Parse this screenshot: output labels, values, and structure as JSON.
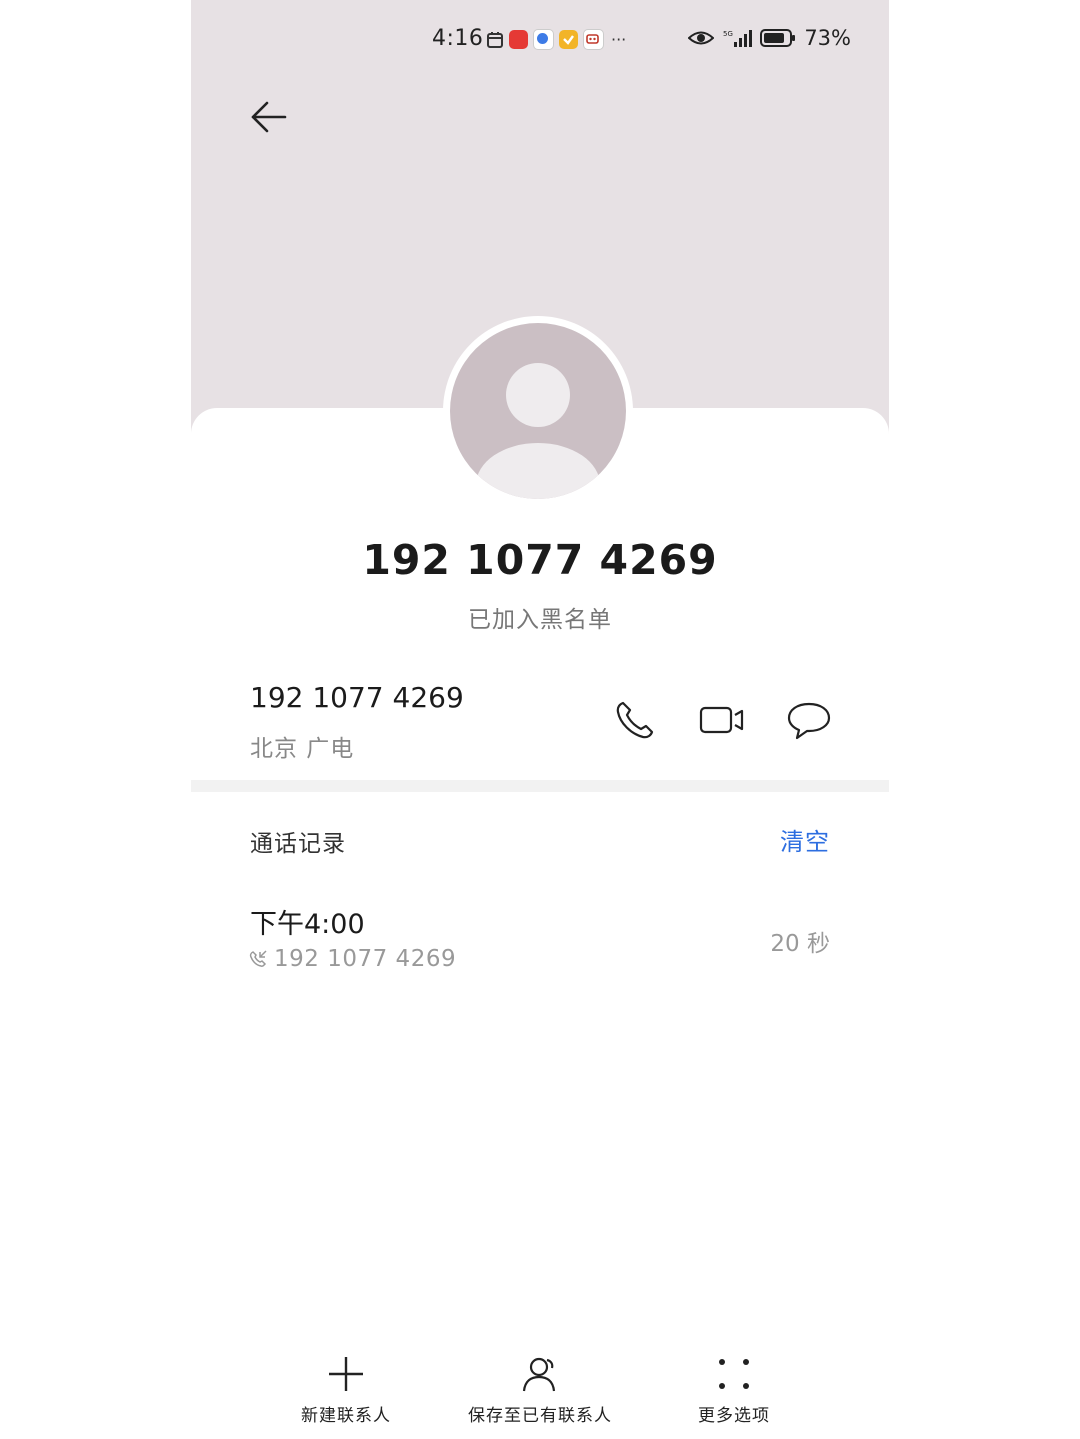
{
  "status_bar": {
    "time": "4:16",
    "battery_percent": "73%"
  },
  "contact": {
    "display_number": "192 1077 4269",
    "blacklist_status": "已加入黑名单",
    "number": "192 1077 4269",
    "carrier": "北京 广电"
  },
  "call_log": {
    "title": "通话记录",
    "clear_label": "清空",
    "items": [
      {
        "time": "下午4:00",
        "number": "192 1077 4269",
        "duration": "20 秒"
      }
    ]
  },
  "bottom_bar": {
    "new_contact": "新建联系人",
    "save_existing": "保存至已有联系人",
    "more_options": "更多选项"
  },
  "colors": {
    "hero_background": "#e7e1e4",
    "avatar_background": "#cbbfc4",
    "accent": "#2d6ee0"
  },
  "icons": {
    "back": "arrow-left-icon",
    "call": "phone-icon",
    "video": "video-camera-icon",
    "message": "chat-bubble-icon",
    "log_call_type": "incoming-call-icon",
    "new_contact": "plus-icon",
    "save_existing": "person-icon",
    "more": "four-dots-icon"
  }
}
